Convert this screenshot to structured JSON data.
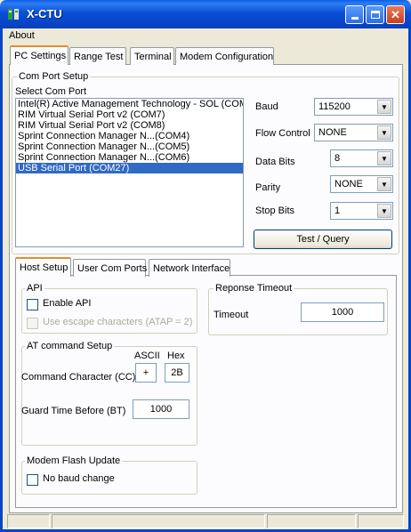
{
  "window": {
    "title": "X-CTU"
  },
  "menu": {
    "about": "About"
  },
  "main_tabs": [
    "PC Settings",
    "Range Test",
    "Terminal",
    "Modem Configuration"
  ],
  "com_port_setup": {
    "group_label": "Com Port Setup",
    "list_label": "Select Com Port",
    "ports": [
      "Intel(R) Active Management Technology - SOL (COM",
      "RIM Virtual Serial Port v2 (COM7)",
      "RIM Virtual Serial Port v2 (COM8)",
      "Sprint Connection Manager N...(COM4)",
      "Sprint Connection Manager N...(COM5)",
      "Sprint Connection Manager N...(COM6)",
      "USB Serial Port (COM27)"
    ],
    "selected_index": 6
  },
  "settings": {
    "baud_label": "Baud",
    "baud_value": "115200",
    "flow_label": "Flow Control",
    "flow_value": "NONE",
    "databits_label": "Data Bits",
    "databits_value": "8",
    "parity_label": "Parity",
    "parity_value": "NONE",
    "stopbits_label": "Stop Bits",
    "stopbits_value": "1",
    "test_button": "Test / Query"
  },
  "sub_tabs": [
    "Host Setup",
    "User Com Ports",
    "Network Interface"
  ],
  "api": {
    "group_label": "API",
    "enable_label": "Enable API",
    "escape_label": "Use escape characters (ATAP = 2)"
  },
  "at_command": {
    "group_label": "AT command Setup",
    "ascii_header": "ASCII",
    "hex_header": "Hex",
    "cc_label": "Command Character (CC)",
    "cc_ascii": "+",
    "cc_hex": "2B",
    "bt_label": "Guard Time Before (BT)",
    "bt_value": "1000"
  },
  "response_timeout": {
    "group_label": "Reponse Timeout",
    "timeout_label": "Timeout",
    "timeout_value": "1000"
  },
  "modem_flash": {
    "group_label": "Modem Flash Update",
    "no_baud_label": "No baud change"
  },
  "icons": {
    "minimize": "minimize-icon",
    "maximize": "maximize-icon",
    "close": "close-icon",
    "dropdown": "chevron-down-icon"
  }
}
